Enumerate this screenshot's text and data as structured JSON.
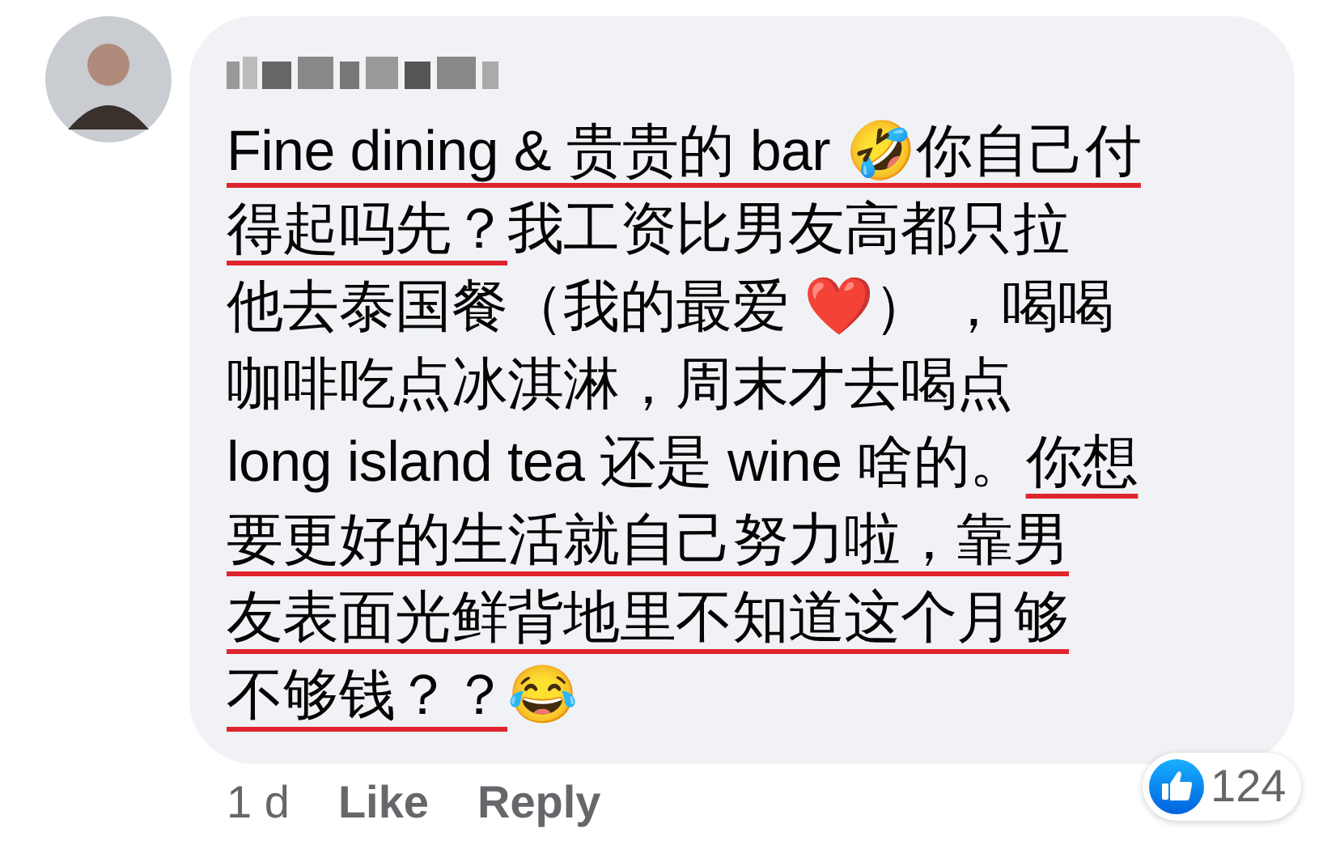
{
  "comment": {
    "lines": [
      [
        {
          "text": "Fine dining & 贵贵的 bar 🤣你自己付",
          "underlined": true
        }
      ],
      [
        {
          "text": "得起吗先？",
          "underlined": true
        },
        {
          "text": "我工资比男友高都只拉",
          "underlined": false
        }
      ],
      [
        {
          "text": "他去泰国餐（我的最爱 ❤️）  ，喝喝",
          "underlined": false
        }
      ],
      [
        {
          "text": "咖啡吃点冰淇淋，周末才去喝点",
          "underlined": false
        }
      ],
      [
        {
          "text": "long island tea 还是 wine 啥的。",
          "underlined": false
        },
        {
          "text": "你想",
          "underlined": true
        }
      ],
      [
        {
          "text": "要更好的生活就自己努力啦，靠男",
          "underlined": true
        }
      ],
      [
        {
          "text": "友表面光鲜背地里不知道这个月够",
          "underlined": true
        }
      ],
      [
        {
          "text": "不够钱？？",
          "underlined": true
        },
        {
          "text": "😂",
          "underlined": false
        }
      ]
    ]
  },
  "actions": {
    "time": "1 d",
    "like": "Like",
    "reply": "Reply"
  },
  "reactions": {
    "count": "124"
  }
}
